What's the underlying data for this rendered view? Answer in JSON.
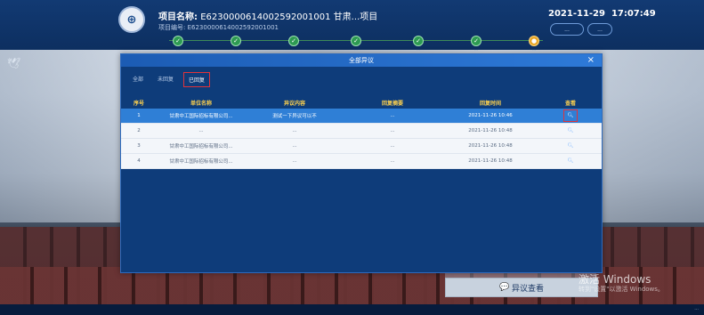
{
  "header": {
    "project_label": "项目名称:",
    "project_id": "E6230000614002592001001",
    "project_name": "甘肃...项目",
    "project_no_label": "项目编号:",
    "project_no": "E6230000614002592001001",
    "date": "2021-11-29",
    "time": "17:07:49",
    "btn1": "...",
    "btn2": "..."
  },
  "steps": [
    {
      "label": "..."
    },
    {
      "label": "..."
    },
    {
      "label": "..."
    },
    {
      "label": "..."
    },
    {
      "label": "..."
    },
    {
      "label": "..."
    },
    {
      "label": "..."
    }
  ],
  "modal": {
    "title": "全部异议",
    "close": "×",
    "tabs": [
      "全部",
      "未回复",
      "已回复"
    ],
    "columns": [
      "序号",
      "单位名称",
      "异议内容",
      "回复摘要",
      "回复时间",
      "查看"
    ],
    "rows": [
      {
        "no": "1",
        "unit": "甘肃中工国际招标有限公司...",
        "content": "测试一下异议可以不",
        "reply": "...",
        "time": "2021-11-26 10:46"
      },
      {
        "no": "2",
        "unit": "...",
        "content": "...",
        "reply": "...",
        "time": "2021-11-26 10:48"
      },
      {
        "no": "3",
        "unit": "甘肃中工国际招标有限公司...",
        "content": "...",
        "reply": "...",
        "time": "2021-11-26 10:48"
      },
      {
        "no": "4",
        "unit": "甘肃中工国际招标有限公司...",
        "content": "...",
        "reply": "...",
        "time": "2021-11-26 10:48"
      }
    ]
  },
  "right_panel": {
    "tip": "...",
    "feedback_button": "异议查看"
  },
  "windows": {
    "activate": "激活 Windows",
    "activate_sub": "转到\"设置\"以激活 Windows。"
  },
  "footer": "..."
}
